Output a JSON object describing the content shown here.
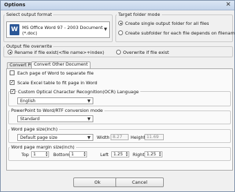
{
  "window": {
    "title": "Options",
    "close_glyph": "✕"
  },
  "output_format": {
    "legend": "Select output format",
    "selected_line1": "MS Office Word 97 - 2003 Document",
    "selected_line2": "(*.doc)",
    "icon": "word-document-icon"
  },
  "target_folder": {
    "legend": "Target folder mode",
    "options": [
      {
        "label": "Create single output folder for all files",
        "selected": true
      },
      {
        "label": "Create subfolder for each file depends on filename",
        "selected": false
      }
    ]
  },
  "overwrite": {
    "legend": "Output file overwrite",
    "options": [
      {
        "label": "Rename if file exist(<file name>+index)",
        "selected": true
      },
      {
        "label": "Overwrite if file exist",
        "selected": false
      }
    ]
  },
  "tabs": [
    {
      "label": "Convert PDF",
      "active": false
    },
    {
      "label": "Convert Other Document",
      "active": true
    }
  ],
  "options": {
    "each_page_label": "Each page of Word to separate file",
    "each_page_checked": false,
    "scale_excel_label": "Scale Excel table to fit page in Word",
    "scale_excel_checked": true,
    "ocr_label": "Custom Optical Character Recognition(OCR) Language",
    "ocr_checked": true,
    "ocr_language": "English",
    "ppt_legend": "PowerPoint to Word/RTF conversion mode",
    "ppt_mode": "Standard",
    "page_size_legend": "Word page size(inch)",
    "page_size": "Default page size",
    "width_label": "Width",
    "width_value": "8.27",
    "height_label": "Height",
    "height_value": "11.69",
    "margin_legend": "Word page margin size(inch)",
    "top_label": "Top",
    "top_value": "1",
    "bottom_label": "Bottom",
    "bottom_value": "1",
    "left_label": "Left",
    "left_value": "1.25",
    "right_label": "Right",
    "right_value": "1.25"
  },
  "buttons": {
    "ok": "Ok",
    "cancel": "Cancel"
  }
}
